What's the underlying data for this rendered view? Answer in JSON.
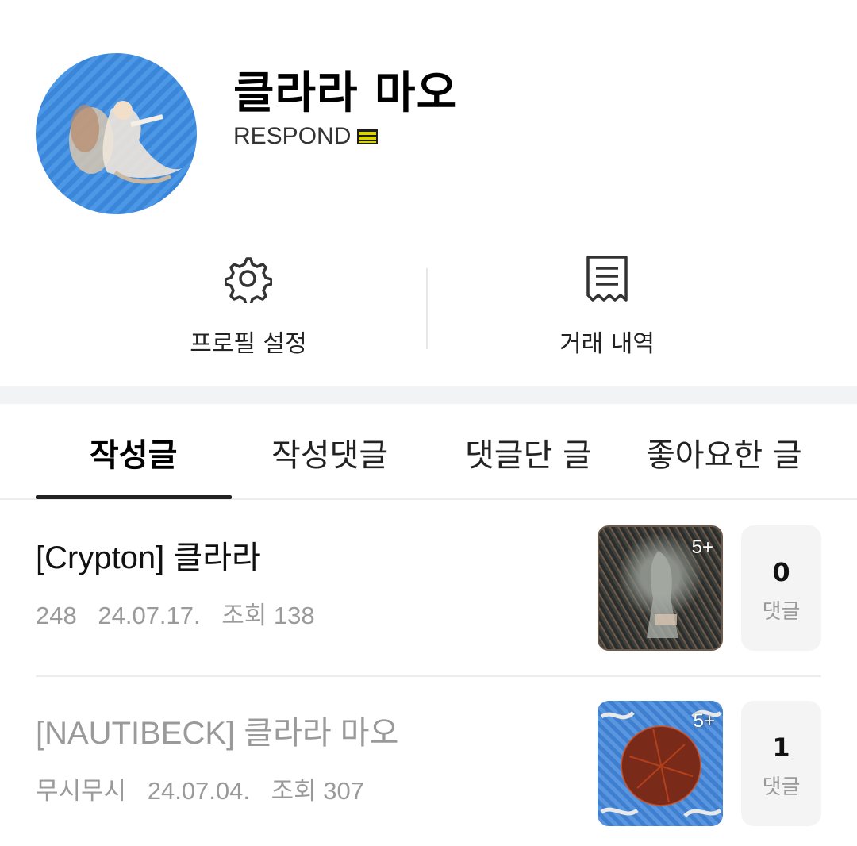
{
  "profile": {
    "name": "클라라 마오",
    "level_text": "RESPOND"
  },
  "actions": {
    "settings_label": "프로필 설정",
    "history_label": "거래 내역"
  },
  "tabs": [
    {
      "label": "작성글",
      "active": true
    },
    {
      "label": "작성댓글",
      "active": false
    },
    {
      "label": "댓글단 글",
      "active": false
    },
    {
      "label": "좋아요한 글",
      "active": false
    }
  ],
  "posts": [
    {
      "title": "[Crypton] 클라라",
      "author": "248",
      "date": "24.07.17.",
      "views": "조회 138",
      "image_badge": "5+",
      "comment_count": "0",
      "comment_label": "댓글"
    },
    {
      "title": "[NAUTIBECK] 클라라 마오",
      "author": "무시무시",
      "date": "24.07.04.",
      "views": "조회 307",
      "image_badge": "5+",
      "comment_count": "1",
      "comment_label": "댓글"
    }
  ]
}
